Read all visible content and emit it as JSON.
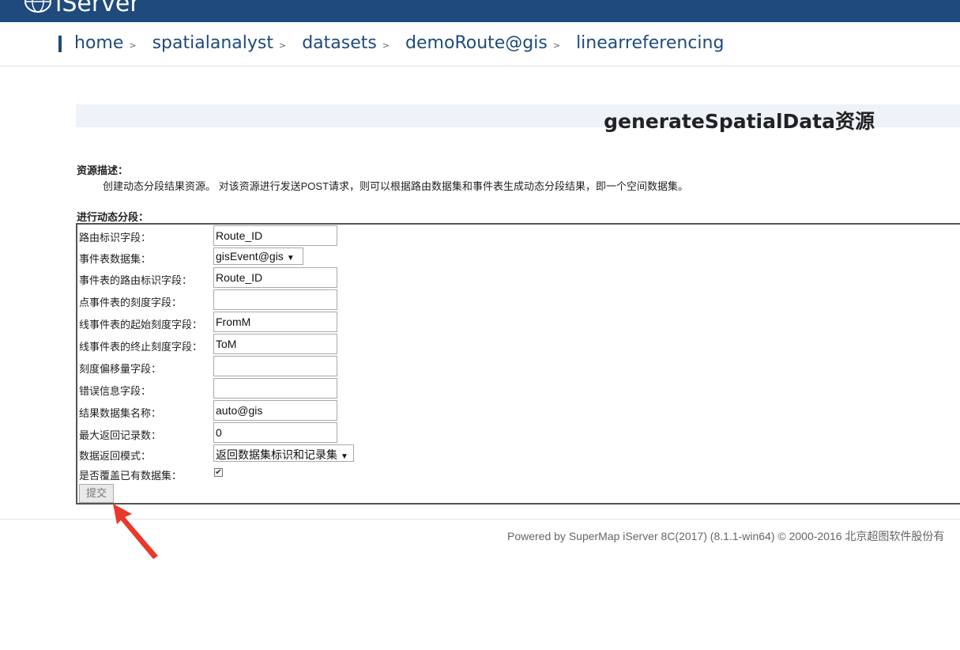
{
  "header": {
    "logo_text": "iServer",
    "brand_color": "#1f4a7c"
  },
  "breadcrumb": {
    "items": [
      "home",
      "spatialanalyst",
      "datasets",
      "demoRoute@gis",
      "linearreferencing"
    ],
    "separator": ">"
  },
  "page": {
    "title": "generateSpatialData资源"
  },
  "description": {
    "label": "资源描述：",
    "text": "创建动态分段结果资源。 对该资源进行发送POST请求，则可以根据路由数据集和事件表生成动态分段结果，即一个空间数据集。"
  },
  "form": {
    "section_label": "进行动态分段：",
    "fields": [
      {
        "label": "路由标识字段：",
        "value": "Route_ID"
      },
      {
        "label": "事件表数据集：",
        "value": "gisEvent@gis"
      },
      {
        "label": "事件表的路由标识字段：",
        "value": "Route_ID"
      },
      {
        "label": "点事件表的刻度字段：",
        "value": ""
      },
      {
        "label": "线事件表的起始刻度字段：",
        "value": "FromM"
      },
      {
        "label": "线事件表的终止刻度字段：",
        "value": "ToM"
      },
      {
        "label": "刻度偏移量字段：",
        "value": ""
      },
      {
        "label": "错误信息字段：",
        "value": ""
      },
      {
        "label": "结果数据集名称：",
        "value": "auto@gis"
      },
      {
        "label": "最大返回记录数：",
        "value": "0"
      },
      {
        "label": "数据返回模式：",
        "value": "返回数据集标识和记录集"
      },
      {
        "label": "是否覆盖已有数据集：",
        "checked": true
      }
    ],
    "submit_label": "提交"
  },
  "footer": {
    "text": "Powered by SuperMap iServer 8C(2017) (8.1.1-win64) © 2000-2016 北京超图软件股份有"
  },
  "annotation": {
    "arrow_color": "#e8392b",
    "arrow_icon": "red-arrow-icon"
  }
}
